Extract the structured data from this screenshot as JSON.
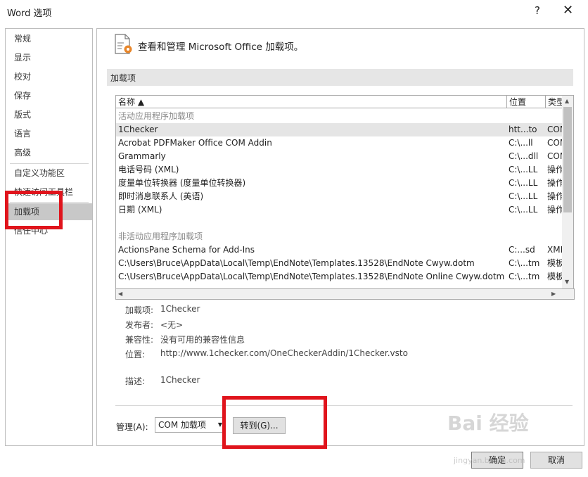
{
  "window": {
    "title": "Word 选项",
    "help": "?",
    "close": "✕"
  },
  "nav": {
    "items": [
      "常规",
      "显示",
      "校对",
      "保存",
      "版式",
      "语言",
      "高级",
      "自定义功能区",
      "快速访问工具栏",
      "加载项",
      "信任中心"
    ],
    "selected": "加载项"
  },
  "main": {
    "header": "查看和管理 Microsoft Office 加载项。",
    "section_title": "加载项"
  },
  "list": {
    "columns": [
      "名称 ▲",
      "位置",
      "类型"
    ],
    "groups": [
      "活动应用程序加载项",
      "非活动应用程序加载项"
    ],
    "active_rows": [
      {
        "name": "1Checker",
        "location": "htt...to",
        "type": "COM"
      },
      {
        "name": "Acrobat PDFMaker Office COM Addin",
        "location": "C:\\...ll",
        "type": "COM"
      },
      {
        "name": "Grammarly",
        "location": "C:\\...dll",
        "type": "COM"
      },
      {
        "name": "电话号码 (XML)",
        "location": "C:\\...LL",
        "type": "操作"
      },
      {
        "name": "度量单位转换器 (度量单位转换器)",
        "location": "C:\\...LL",
        "type": "操作"
      },
      {
        "name": "即时消息联系人 (英语)",
        "location": "C:\\...LL",
        "type": "操作"
      },
      {
        "name": "日期 (XML)",
        "location": "C:\\...LL",
        "type": "操作"
      }
    ],
    "inactive_rows": [
      {
        "name": "ActionsPane Schema for Add-Ins",
        "location": "C:...sd",
        "type": "XML"
      },
      {
        "name": "C:\\Users\\Bruce\\AppData\\Local\\Temp\\EndNote\\Templates.13528\\EndNote Cwyw.dotm",
        "location": "C:\\...tm",
        "type": "模板"
      },
      {
        "name": "C:\\Users\\Bruce\\AppData\\Local\\Temp\\EndNote\\Templates.13528\\EndNote Online Cwyw.dotm",
        "location": "C:\\...tm",
        "type": "模板"
      }
    ]
  },
  "details": {
    "addin_label": "加载项:",
    "addin_value": "1Checker",
    "publisher_label": "发布者:",
    "publisher_value": "<无>",
    "compat_label": "兼容性:",
    "compat_value": "没有可用的兼容性信息",
    "location_label": "位置:",
    "location_value": "http://www.1checker.com/OneCheckerAddin/1Checker.vsto",
    "desc_label": "描述:",
    "desc_value": "1Checker"
  },
  "manage": {
    "label": "管理(A):",
    "selected": "COM 加载项",
    "go": "转到(G)..."
  },
  "buttons": {
    "ok": "确定",
    "cancel": "取消"
  },
  "watermark": {
    "text": "Bai 经验",
    "url": "jingyan.baidu.com"
  },
  "colors": {
    "highlight_box": "#e0141c",
    "selected_nav": "#c8c8c8"
  }
}
